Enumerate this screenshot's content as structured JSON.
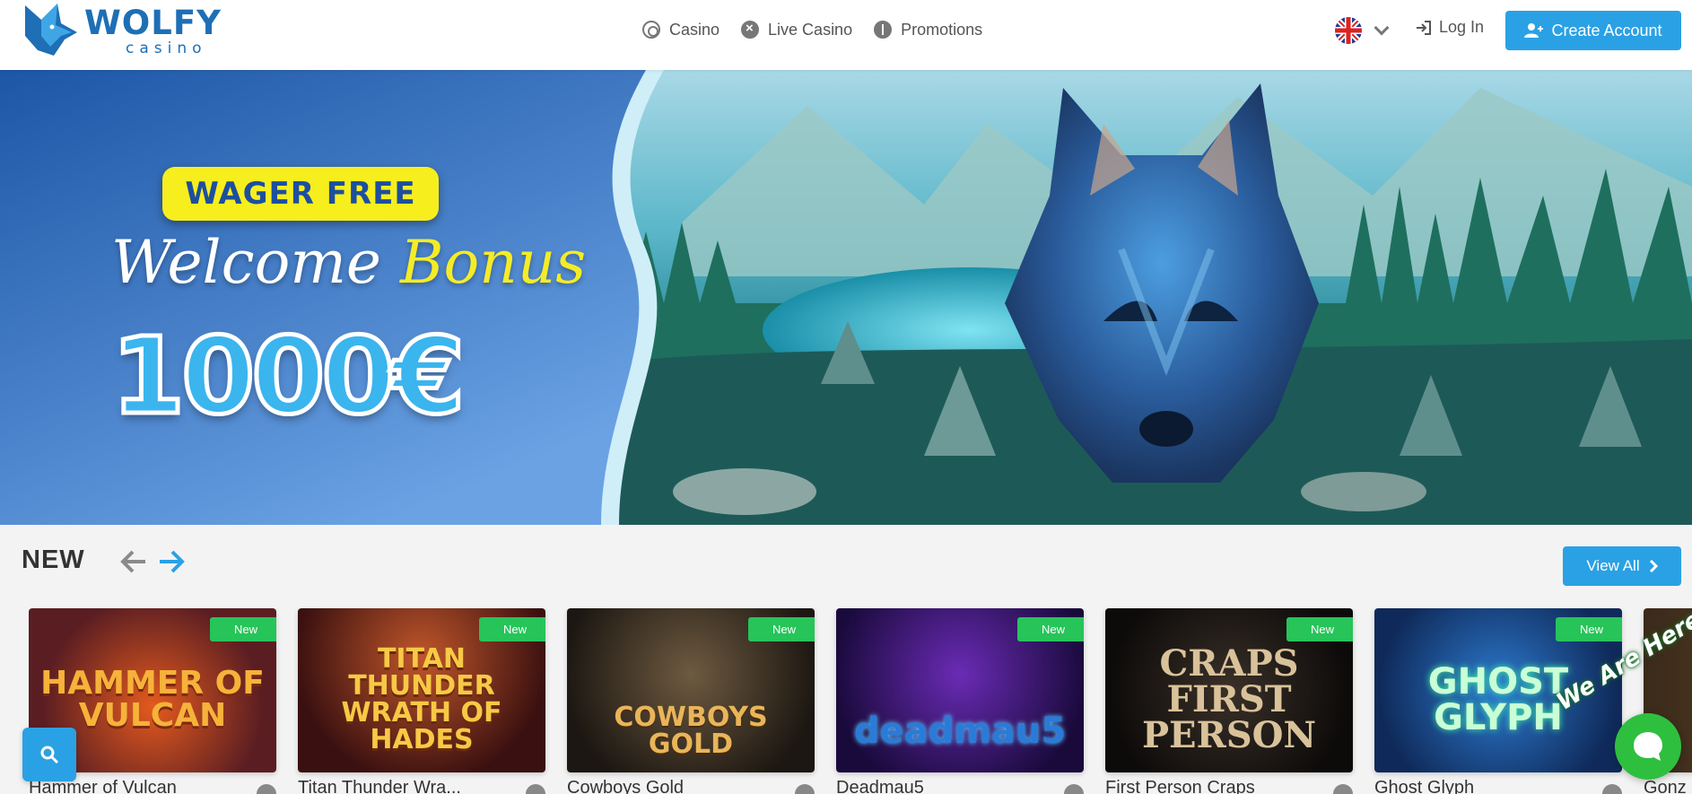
{
  "header": {
    "logo_word": "WOLFY",
    "logo_sub": "casino",
    "nav": [
      {
        "label": "Casino",
        "icon": "casino-chip-icon"
      },
      {
        "label": "Live Casino",
        "icon": "live-casino-icon"
      },
      {
        "label": "Promotions",
        "icon": "gift-icon"
      }
    ],
    "language_icon": "uk-flag-icon",
    "login_label": "Log In",
    "create_account_label": "Create Account",
    "accent_color": "#2aa1e4"
  },
  "banner": {
    "badge": "WAGER FREE",
    "welcome": "Welcome",
    "bonus": "Bonus",
    "amount": "1000€"
  },
  "new_section": {
    "title": "NEW",
    "view_all_label": "View All",
    "games": [
      {
        "title": "Hammer of Vulcan",
        "badge": "New",
        "art": "HAMMER OF VULCAN"
      },
      {
        "title": "Titan Thunder Wra...",
        "badge": "New",
        "art": "TITAN THUNDER WRATH OF HADES"
      },
      {
        "title": "Cowboys Gold",
        "badge": "New",
        "art": "COWBOYS GOLD"
      },
      {
        "title": "Deadmau5",
        "badge": "New",
        "art": "deadmau5"
      },
      {
        "title": "First Person Craps",
        "badge": "New",
        "art": "CRAPS FIRST PERSON"
      },
      {
        "title": "Ghost Glyph",
        "badge": "New",
        "art": "GHOST GLYPH"
      },
      {
        "title": "Gonz",
        "badge": "",
        "art": ""
      }
    ]
  },
  "chat": {
    "label": "We Are Here!"
  }
}
